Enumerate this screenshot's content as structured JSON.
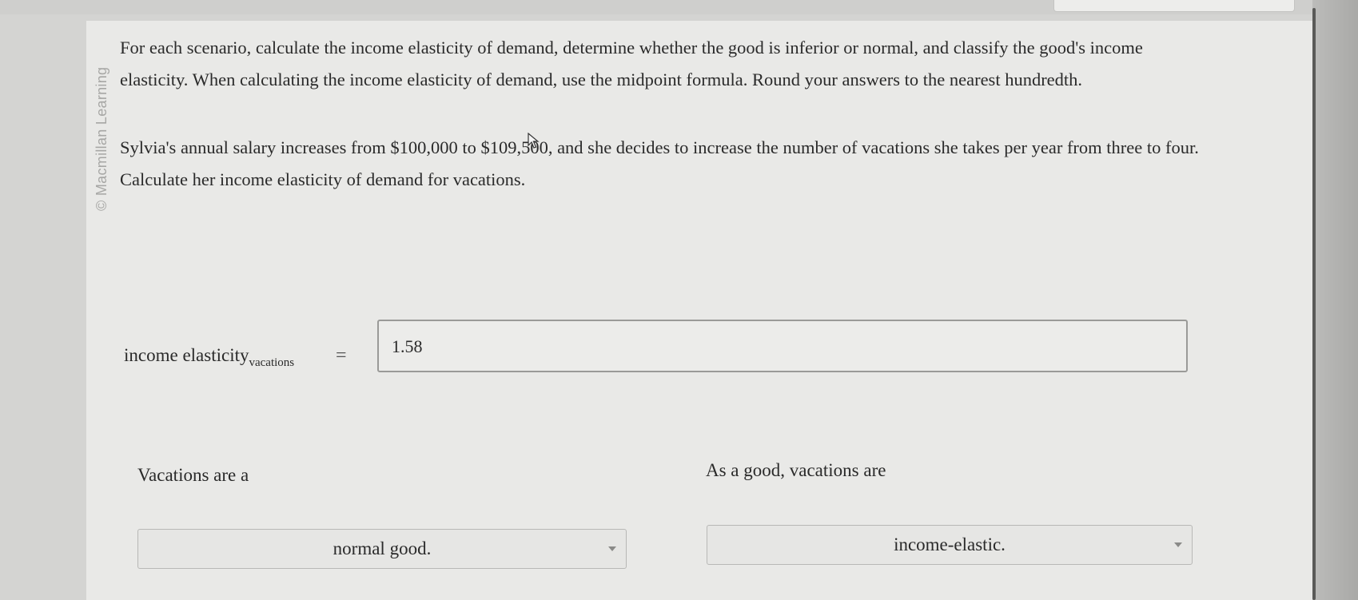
{
  "watermark": "© Macmillan Learning",
  "question": {
    "instructions": "For each scenario, calculate the income elasticity of demand, determine whether the good is inferior or normal, and classify the good's income elasticity. When calculating the income elasticity of demand, use the midpoint formula. Round your answers to the nearest hundredth.",
    "scenario": "Sylvia's annual salary increases from $100,000 to $109,500, and she decides to increase the number of vacations she takes per year from three to four. Calculate her income elasticity of demand for vacations."
  },
  "equation": {
    "label_main": "income elasticity",
    "label_sub": "vacations",
    "equals": "=",
    "answer": "1.58"
  },
  "good_type": {
    "prompt": "Vacations are a",
    "selected": "normal good."
  },
  "elasticity_class": {
    "prompt": "As a good, vacations are",
    "selected": "income-elastic."
  },
  "icons": {
    "cursor": "mouse-pointer-icon",
    "dropdown": "chevron-down-icon"
  }
}
